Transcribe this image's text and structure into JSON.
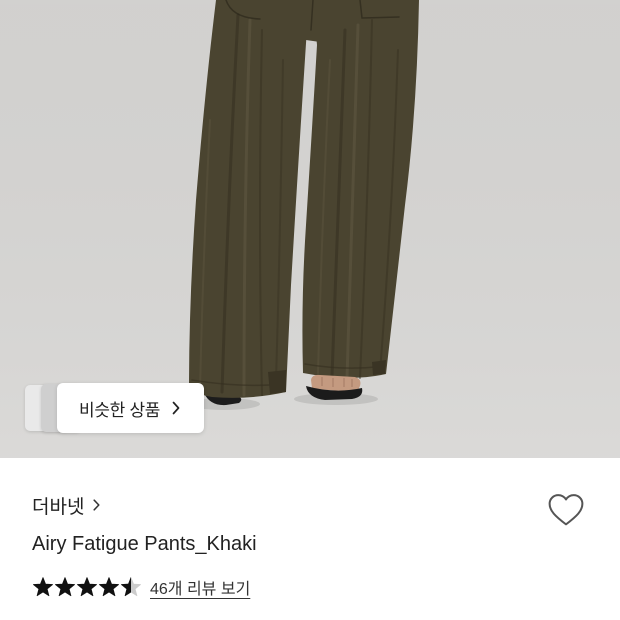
{
  "product_image": {
    "background_color": "#d8d7d5",
    "pants_color": "#4a4430"
  },
  "similar_products_button": {
    "label": "비슷한 상품",
    "icon": "chevron-right-icon"
  },
  "brand": {
    "name": "더바넷",
    "icon": "chevron-right-icon"
  },
  "wishlist": {
    "icon": "heart-icon"
  },
  "product": {
    "name": "Airy Fatigue Pants_Khaki"
  },
  "rating": {
    "value": 4.5,
    "max": 5,
    "icon": "star-icon",
    "filled_color": "#111111",
    "empty_color": "#cccccc",
    "review_link": "46개 리뷰 보기"
  },
  "colors": {
    "text_primary": "#222222",
    "icon_gray": "#555555"
  }
}
